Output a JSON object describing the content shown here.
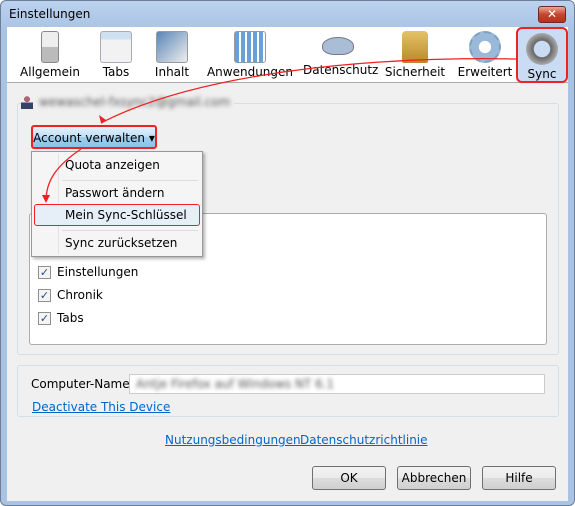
{
  "window": {
    "title": "Einstellungen",
    "close_label": "✕"
  },
  "toolbar": [
    {
      "label": "Allgemein",
      "icon": "switch-icon"
    },
    {
      "label": "Tabs",
      "icon": "tabs-icon"
    },
    {
      "label": "Inhalt",
      "icon": "content-icon"
    },
    {
      "label": "Anwendungen",
      "icon": "applications-icon"
    },
    {
      "label": "Datenschutz",
      "icon": "mask-icon"
    },
    {
      "label": "Sicherheit",
      "icon": "lock-icon"
    },
    {
      "label": "Erweitert",
      "icon": "gear-icon"
    },
    {
      "label": "Sync",
      "icon": "sync-icon",
      "selected": true
    }
  ],
  "account": {
    "email": "wewaschel-fxsync2@gmail.com",
    "manage_label": "Account verwalten"
  },
  "menu": [
    "Quota anzeigen",
    "Passwort ändern",
    "Mein Sync-Schlüssel",
    "Sync zurücksetzen"
  ],
  "sync_items": [
    "Einstellungen",
    "Chronik",
    "Tabs"
  ],
  "computer": {
    "label": "Computer-Name:",
    "value": "Antje Firefox auf Windows NT 6.1",
    "deactivate": "Deactivate This Device"
  },
  "links": {
    "terms": "Nutzungsbedingungen",
    "privacy": "Datenschutzrichtlinie"
  },
  "buttons": {
    "ok": "OK",
    "cancel": "Abbrechen",
    "help": "Hilfe"
  },
  "colors": {
    "highlight": "#e22222",
    "link": "#0066cc"
  }
}
